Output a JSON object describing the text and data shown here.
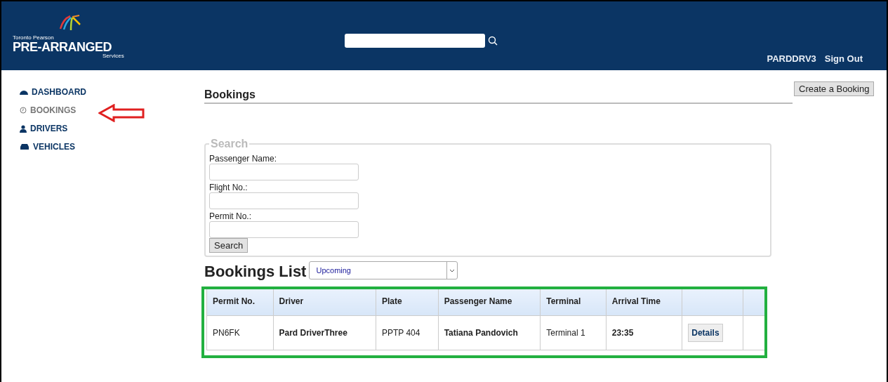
{
  "header": {
    "logo": {
      "line1": "Toronto Pearson",
      "line2": "PRE-ARRANGED",
      "line3": "Services"
    },
    "user": "PARDDRV3",
    "sign_out": "Sign Out"
  },
  "sidebar": {
    "items": [
      {
        "label": "DASHBOARD",
        "selected": false
      },
      {
        "label": "BOOKINGS",
        "selected": true
      },
      {
        "label": "DRIVERS",
        "selected": false
      },
      {
        "label": "VEHICLES",
        "selected": false
      }
    ]
  },
  "page_title": "Bookings",
  "create_button": "Create a Booking",
  "search_panel": {
    "legend": "Search",
    "fields": [
      {
        "label": "Passenger Name:"
      },
      {
        "label": "Flight No.:"
      },
      {
        "label": "Permit No.:"
      }
    ],
    "button": "Search"
  },
  "bookings_list": {
    "title": "Bookings List",
    "filter": "Upcoming"
  },
  "table": {
    "columns": [
      "Permit No.",
      "Driver",
      "Plate",
      "Passenger Name",
      "Terminal",
      "Arrival Time"
    ],
    "rows": [
      {
        "cells": [
          {
            "text": "PN6FK",
            "bold": false
          },
          {
            "text": "Pard DriverThree",
            "bold": true
          },
          {
            "text": "PPTP 404",
            "bold": false
          },
          {
            "text": "Tatiana Pandovich",
            "bold": true
          },
          {
            "text": "Terminal 1",
            "bold": false
          },
          {
            "text": "23:35",
            "bold": true
          }
        ],
        "action": "Details"
      }
    ]
  }
}
